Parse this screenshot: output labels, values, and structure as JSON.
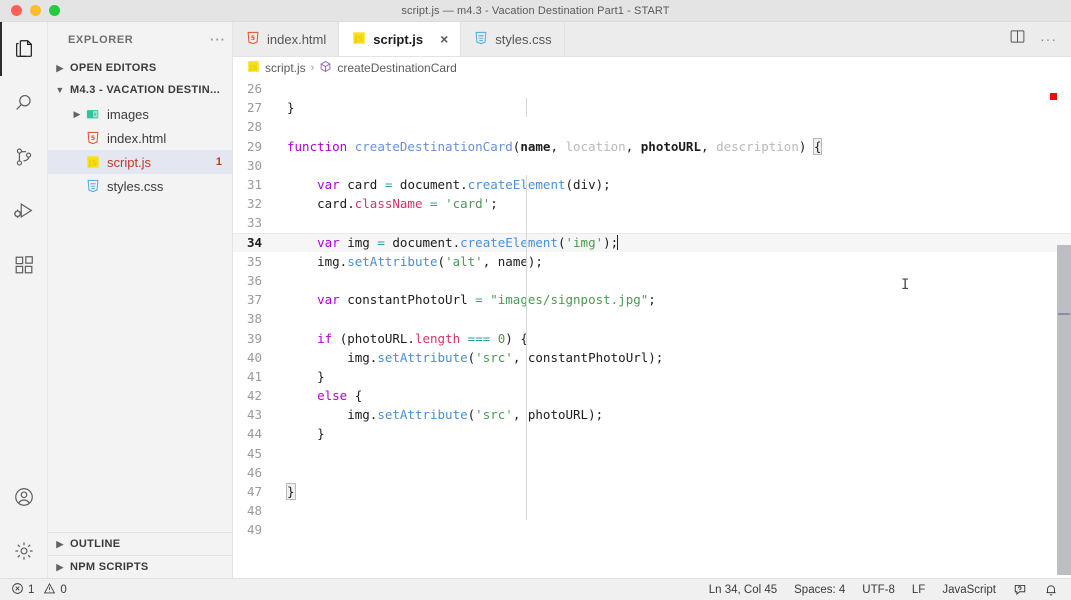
{
  "window": {
    "title": "script.js — m4.3 - Vacation Destination Part1 - START"
  },
  "activity_bar": {
    "items": [
      {
        "name": "explorer",
        "icon": "files-icon",
        "active": true
      },
      {
        "name": "search",
        "icon": "search-icon",
        "active": false
      },
      {
        "name": "source-control",
        "icon": "source-control-icon",
        "active": false
      },
      {
        "name": "run-debug",
        "icon": "run-debug-icon",
        "active": false
      },
      {
        "name": "extensions",
        "icon": "extensions-icon",
        "active": false
      }
    ],
    "bottom_items": [
      {
        "name": "accounts",
        "icon": "account-icon"
      },
      {
        "name": "settings",
        "icon": "gear-icon"
      }
    ]
  },
  "sidebar": {
    "title": "EXPLORER",
    "more_actions": "···",
    "sections": [
      {
        "label": "OPEN EDITORS",
        "expanded": false
      },
      {
        "label": "M4.3 - VACATION DESTIN...",
        "expanded": true
      }
    ],
    "files": [
      {
        "label": "images",
        "icon": "folder-icon",
        "type": "folder",
        "selected": false,
        "badge": ""
      },
      {
        "label": "index.html",
        "icon": "html-icon",
        "type": "file",
        "selected": false,
        "badge": ""
      },
      {
        "label": "script.js",
        "icon": "js-icon",
        "type": "file",
        "selected": true,
        "badge": "1"
      },
      {
        "label": "styles.css",
        "icon": "css-icon",
        "type": "file",
        "selected": false,
        "badge": ""
      }
    ],
    "bottom_sections": [
      {
        "label": "OUTLINE",
        "expanded": false
      },
      {
        "label": "NPM SCRIPTS",
        "expanded": false
      }
    ]
  },
  "tabs": [
    {
      "label": "index.html",
      "icon": "html-icon",
      "active": false
    },
    {
      "label": "script.js",
      "icon": "js-icon",
      "active": true,
      "close": "×"
    },
    {
      "label": "styles.css",
      "icon": "css-icon",
      "active": false
    }
  ],
  "tab_actions": {
    "split_editor": "split-editor-icon",
    "more": "···"
  },
  "breadcrumb": {
    "file": "script.js",
    "separator": "›",
    "symbol": "createDestinationCard"
  },
  "editor": {
    "first_line": 26,
    "current_line": 34,
    "lines": [
      {
        "n": 26,
        "text": ""
      },
      {
        "n": 27,
        "text": "}"
      },
      {
        "n": 28,
        "text": ""
      },
      {
        "n": 29,
        "text": "function createDestinationCard(name, location, photoURL, description) {"
      },
      {
        "n": 30,
        "text": ""
      },
      {
        "n": 31,
        "text": "    var card = document.createElement(div);"
      },
      {
        "n": 32,
        "text": "    card.className = 'card';"
      },
      {
        "n": 33,
        "text": ""
      },
      {
        "n": 34,
        "text": "    var img = document.createElement('img');"
      },
      {
        "n": 35,
        "text": "    img.setAttribute('alt', name);"
      },
      {
        "n": 36,
        "text": ""
      },
      {
        "n": 37,
        "text": "    var constantPhotoUrl = \"images/signpost.jpg\";"
      },
      {
        "n": 38,
        "text": ""
      },
      {
        "n": 39,
        "text": "    if (photoURL.length === 0) {"
      },
      {
        "n": 40,
        "text": "        img.setAttribute('src', constantPhotoUrl);"
      },
      {
        "n": 41,
        "text": "    }"
      },
      {
        "n": 42,
        "text": "    else {"
      },
      {
        "n": 43,
        "text": "        img.setAttribute('src', photoURL);"
      },
      {
        "n": 44,
        "text": "    }"
      },
      {
        "n": 45,
        "text": ""
      },
      {
        "n": 46,
        "text": ""
      },
      {
        "n": 47,
        "text": "}"
      },
      {
        "n": 48,
        "text": ""
      },
      {
        "n": 49,
        "text": ""
      }
    ]
  },
  "status_bar": {
    "errors_icon": "error-icon",
    "errors": "1",
    "warnings_icon": "warning-icon",
    "warnings": "0",
    "cursor_position": "Ln 34, Col 45",
    "indentation": "Spaces: 4",
    "encoding": "UTF-8",
    "eol": "LF",
    "language": "JavaScript",
    "feedback_icon": "feedback-icon",
    "notifications_icon": "bell-icon"
  },
  "colors": {
    "accent_error": "#c0392b",
    "keyword": "#af00db",
    "string": "#4a9a52",
    "function": "#6a8fd8",
    "property": "#d6336c",
    "operator": "#2aa198",
    "overview_error": "#e51400",
    "tab_active_bg": "#ffffff",
    "sidebar_bg": "#f3f3f3",
    "selected_row": "#e4e6f1"
  }
}
